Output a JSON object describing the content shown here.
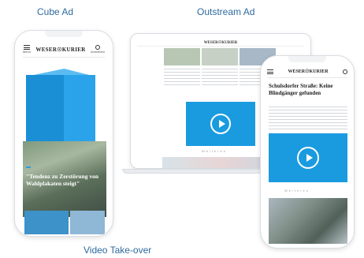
{
  "captions": {
    "cube": "Cube Ad",
    "outstream": "Outstream Ad",
    "video": "Video Take-over"
  },
  "phone_left": {
    "menu_label": "Menü",
    "logo": "WESER☉KURIER",
    "account_label": "Anmelden",
    "badge": "",
    "headline": "\"Tendenz zu Zerstörung von Wahlplakaten steigt\""
  },
  "laptop": {
    "logo": "WESER☉KURIER",
    "separator": "Weiteres"
  },
  "phone_right": {
    "logo": "WESER☉KURIER",
    "headline": "Schulsdorfer Straße: Keine Blindgänger gefunden",
    "separator": "Weiteres"
  },
  "colors": {
    "accent": "#1a9be0",
    "caption": "#2f6a9e"
  },
  "icons": [
    "menu-icon",
    "user-icon",
    "play-icon"
  ]
}
